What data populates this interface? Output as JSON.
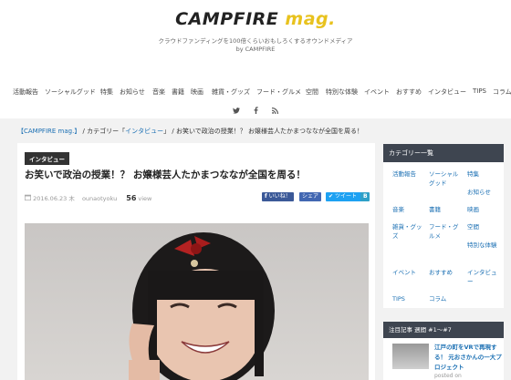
{
  "site": {
    "logo_main": "CAMPFIRE ",
    "logo_accent": "mag.",
    "tagline": "クラウドファンディングを100倍くらいおもしろくするオウンドメディア",
    "byline": "by CAMPFIRE"
  },
  "nav": [
    "活動報告",
    "ソーシャルグッド",
    "特集",
    "お知らせ",
    "音楽",
    "書籍",
    "映画",
    "雑貨・グッズ",
    "フード・グルメ",
    "空間",
    "特別な体験",
    "イベント",
    "おすすめ",
    "インタビュー",
    "TIPS",
    "コラム"
  ],
  "social": {
    "twitter": "twitter-icon",
    "facebook": "facebook-icon",
    "rss": "rss-icon"
  },
  "breadcrumb": {
    "home": "【CAMPFIRE mag.】",
    "sep1": " / ",
    "category_prefix": "カテゴリー「",
    "category": "インタビュー",
    "category_suffix": "」",
    "sep2": " / ",
    "current": "お笑いで政治の授業！？ お嬢様芸人たかまつななが全国を周る！"
  },
  "article": {
    "badge": "インタビュー",
    "title": "お笑いで政治の授業！？ お嬢様芸人たかまつななが全国を周る！",
    "date": "2016.06.23 木",
    "author": "ounaotyoku",
    "views": "56",
    "views_label": "view",
    "share_fb": "いいね！",
    "share_fb2": "シェア",
    "share_tw": "ツイート"
  },
  "sidebar": {
    "categories_title": "カテゴリー一覧",
    "categories": [
      [
        "活動報告",
        "ソーシャルグッド",
        "特集"
      ],
      [
        "",
        "",
        "お知らせ"
      ],
      [
        "音楽",
        "書籍",
        "映画"
      ],
      [
        "雑貨・グッズ",
        "フード・グルメ",
        "空間"
      ],
      [
        "",
        "",
        "特別な体験"
      ],
      [
        "イベント",
        "おすすめ",
        "インタビュー"
      ],
      [
        "TIPS",
        "コラム",
        ""
      ]
    ],
    "popular_title": "注目記事 週間 #1〜#7",
    "popular_item_title": "江戸の町をVRで再現する！ 元おさかんの一大プロジェクト",
    "popular_item_posted": "posted on"
  },
  "colors": {
    "accent": "#1a6fb3",
    "badge": "#333333",
    "sidebar_head": "#3e4550",
    "logo_accent": "#e8c21e"
  }
}
